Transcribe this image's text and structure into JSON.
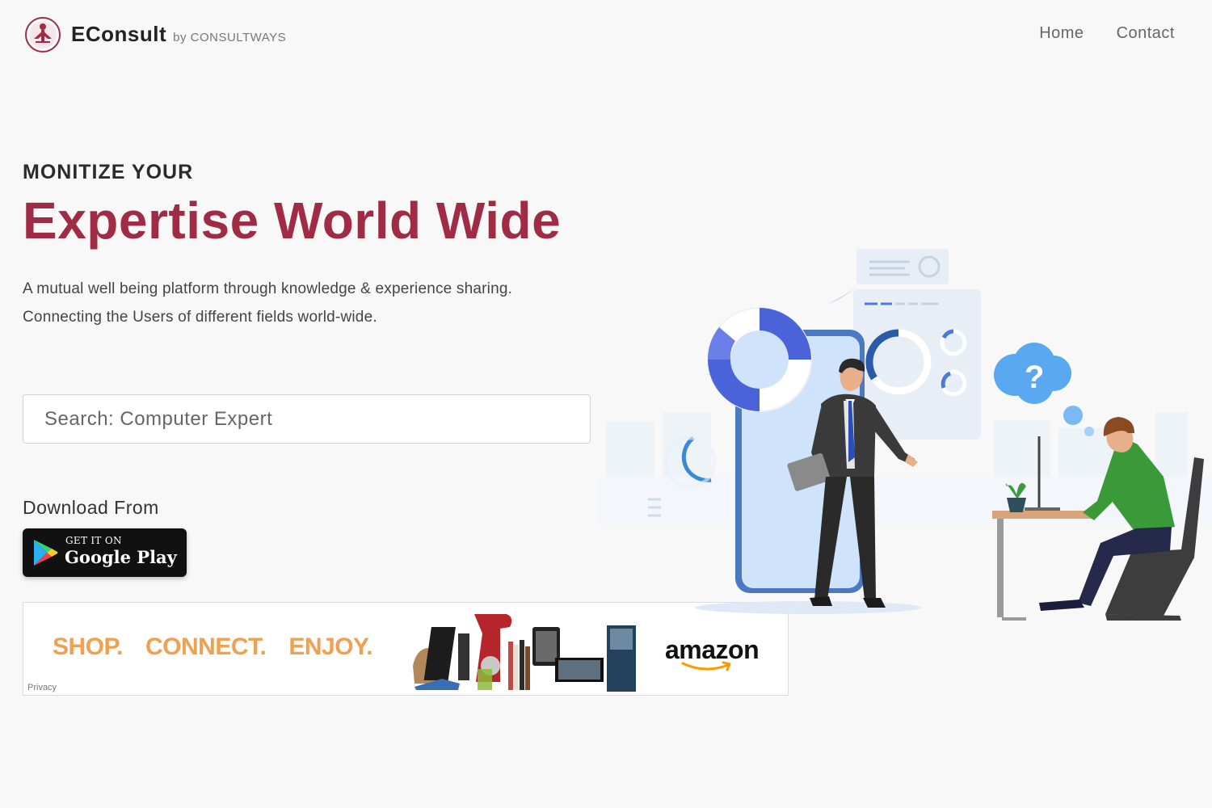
{
  "header": {
    "brand_name": "EConsult",
    "brand_by": "by CONSULTWAYS",
    "nav": [
      {
        "label": "Home"
      },
      {
        "label": "Contact"
      }
    ]
  },
  "hero": {
    "eyebrow": "MONITIZE YOUR",
    "headline": "Expertise World Wide",
    "tagline_line1": "A mutual well being platform through knowledge & experience sharing.",
    "tagline_line2": "Connecting the Users of different fields world-wide."
  },
  "search": {
    "placeholder": "Search: Computer Expert",
    "value": ""
  },
  "download": {
    "label": "Download From",
    "badge_small": "GET IT ON",
    "badge_big": "Google Play"
  },
  "ad": {
    "slogan": [
      "SHOP.",
      "CONNECT.",
      "ENJOY."
    ],
    "brand": "amazon",
    "privacy": "Privacy"
  },
  "illustration": {
    "bubble_text": "?"
  },
  "colors": {
    "accent": "#9f2b44",
    "background": "#f8f8f8",
    "illustration_blue": "#4b63d8",
    "shirt_green": "#3a9a3a",
    "ad_orange": "#f0a050"
  }
}
